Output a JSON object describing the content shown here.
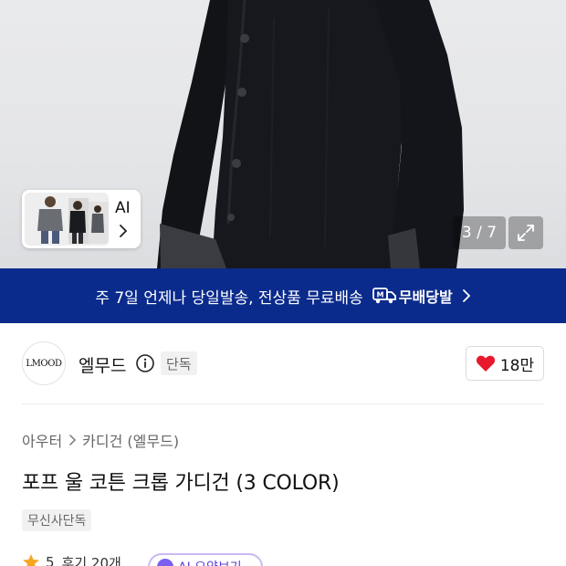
{
  "hero": {
    "ai_card_label": "AI",
    "image_counter": "3 / 7"
  },
  "banner": {
    "text": "주 7일 언제나 당일발송, 전상품 무료배송",
    "badge_label": "무배당발",
    "badge_icon_letter": "M"
  },
  "brand": {
    "logo_text": "LMOOD",
    "name": "엘무드",
    "tag": "단독",
    "likes": "18만"
  },
  "product": {
    "breadcrumb": [
      "아우터",
      "카디건 (엘무드)"
    ],
    "title": "포프 울 코튼 크롭 가디건 (3 COLOR)",
    "tag": "무신사단독",
    "rating": "5",
    "reviews": "후기 20개",
    "ai_pill_label": "AI 요약보기"
  },
  "colors": {
    "banner_bg": "#0b2b8c",
    "heart": "#e8192c",
    "star": "#f5a623"
  }
}
